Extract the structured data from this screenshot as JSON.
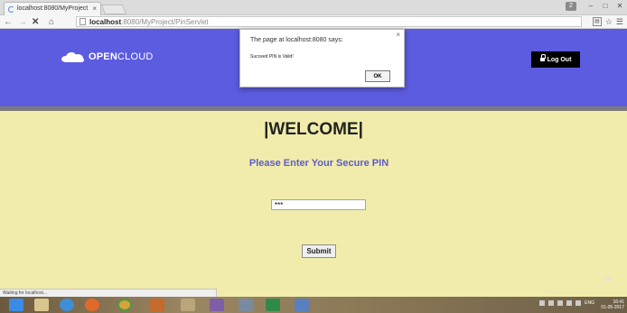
{
  "browser": {
    "tab_title": "localhost:8080/MyProject",
    "tab_close": "×",
    "url_host": "localhost",
    "url_rest": ":8080/MyProject/PinServlet",
    "window_controls": [
      "–",
      "□",
      "✕"
    ],
    "user_button": "2"
  },
  "header": {
    "logo_bold": "OPEN",
    "logo_light": "CLOUD",
    "logout_label": "Log Out",
    "color": "#5c5ce0"
  },
  "main": {
    "welcome": "|WELCOME|",
    "prompt": "Please Enter Your Secure PIN",
    "pin_value": "***",
    "submit_label": "Submit",
    "background": "#f1ecab",
    "prompt_color": "#5c5cc8"
  },
  "dialog": {
    "title": "The page at localhost:8080 says:",
    "message": "Succeed PIN is Valid!",
    "ok_label": "OK",
    "close": "×"
  },
  "status_bar": {
    "text": "Waiting for localhost..."
  },
  "taskbar": {
    "lang": "ENG",
    "time": "16:41",
    "date": "01-05-2017",
    "icons": [
      "windows-start-icon",
      "file-explorer-icon",
      "internet-explorer-icon",
      "firefox-icon",
      "chrome-icon",
      "app-icon",
      "paint-icon",
      "visual-studio-icon",
      "app-icon-2",
      "calculator-icon",
      "shield-icon"
    ]
  }
}
